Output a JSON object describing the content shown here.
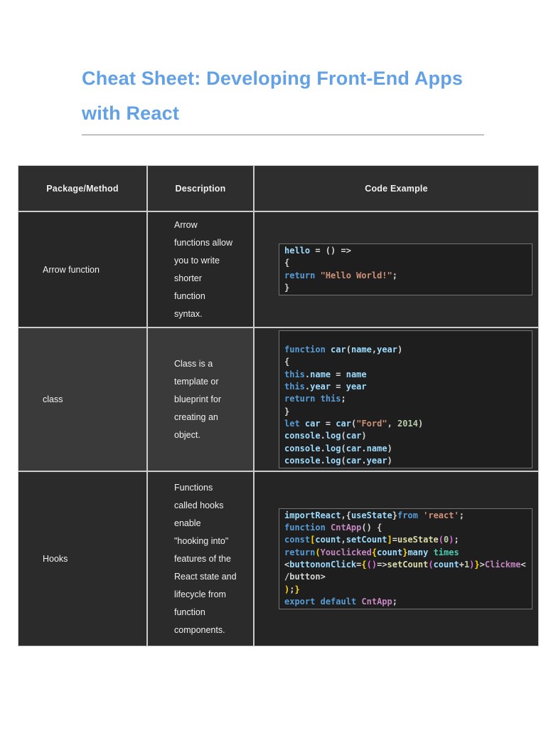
{
  "page": {
    "title": "Cheat Sheet: Developing Front-End Apps\nwith React"
  },
  "colors": {
    "title_blue": "#62A1E6",
    "table_line": "#cccccc",
    "header_bg": "#2e2e2e",
    "code_bg": "#1e1e1e",
    "keyword": "#569CD6",
    "identifier": "#9CDCFE",
    "string": "#CE9178",
    "number": "#B5CEA8",
    "function_call": "#DCDCAA",
    "component": "#C586C0",
    "type": "#4EC9B0",
    "bracket_gold": "#FFD700",
    "bracket_pink": "#DA70D6",
    "code_default": "#D4D4D4"
  },
  "table": {
    "headers": [
      "Package/Method",
      "Description",
      "Code Example"
    ],
    "rows": [
      {
        "package": "Arrow function",
        "description": "Arrow\nfunctions allow\nyou to write\nshorter\nfunction\nsyntax."
      },
      {
        "package": "class",
        "description": "Class is a\ntemplate or\nblueprint for\ncreating an\nobject."
      },
      {
        "package": "Hooks",
        "description": "Functions\ncalled hooks\nenable\n\"hooking into\"\nfeatures of the\nReact state and\nlifecycle from\nfunction\ncomponents."
      }
    ]
  },
  "code_blocks": [
    {
      "lines": [
        [
          [
            "hello",
            "id"
          ],
          [
            " = () =>",
            null
          ]
        ],
        [
          [
            "{",
            null
          ]
        ],
        [
          [
            "return",
            "kw"
          ],
          [
            " ",
            null
          ],
          [
            "\"Hello World!\"",
            "str"
          ],
          [
            ";",
            null
          ]
        ],
        [
          [
            "}",
            null
          ]
        ]
      ]
    },
    {
      "lines": [
        [
          [
            " ",
            null
          ]
        ],
        [
          [
            "function",
            "kw"
          ],
          [
            " ",
            null
          ],
          [
            "car",
            "id"
          ],
          [
            "(",
            null
          ],
          [
            "name",
            "id"
          ],
          [
            ",",
            null
          ],
          [
            "year",
            "id"
          ],
          [
            ")",
            null
          ]
        ],
        [
          [
            "{",
            null
          ]
        ],
        [
          [
            "this",
            "kw"
          ],
          [
            ".",
            null
          ],
          [
            "name",
            "id"
          ],
          [
            " = ",
            null
          ],
          [
            "name",
            "id"
          ]
        ],
        [
          [
            "this",
            "kw"
          ],
          [
            ".",
            null
          ],
          [
            "year",
            "id"
          ],
          [
            " = ",
            null
          ],
          [
            "year",
            "id"
          ]
        ],
        [
          [
            "return",
            "kw"
          ],
          [
            " ",
            null
          ],
          [
            "this",
            "kw"
          ],
          [
            ";",
            null
          ]
        ],
        [
          [
            "}",
            null
          ]
        ],
        [
          [
            "let",
            "kw"
          ],
          [
            " ",
            null
          ],
          [
            "car",
            "id"
          ],
          [
            " = ",
            null
          ],
          [
            "car",
            "id"
          ],
          [
            "(",
            null
          ],
          [
            "\"Ford\"",
            "str"
          ],
          [
            ", ",
            null
          ],
          [
            "2014",
            "num"
          ],
          [
            ")",
            null
          ]
        ],
        [
          [
            "console",
            "id"
          ],
          [
            ".",
            null
          ],
          [
            "log",
            "id"
          ],
          [
            "(",
            null
          ],
          [
            "car",
            "id"
          ],
          [
            ")",
            null
          ]
        ],
        [
          [
            "console",
            "id"
          ],
          [
            ".",
            null
          ],
          [
            "log",
            "id"
          ],
          [
            "(",
            null
          ],
          [
            "car",
            "id"
          ],
          [
            ".",
            null
          ],
          [
            "name",
            "id"
          ],
          [
            ")",
            null
          ]
        ],
        [
          [
            "console",
            "id"
          ],
          [
            ".",
            null
          ],
          [
            "log",
            "id"
          ],
          [
            "(",
            null
          ],
          [
            "car",
            "id"
          ],
          [
            ".",
            null
          ],
          [
            "year",
            "id"
          ],
          [
            ")",
            null
          ]
        ]
      ]
    },
    {
      "lines": [
        [
          [
            "importReact",
            "id"
          ],
          [
            ",",
            null
          ],
          [
            "{",
            null
          ],
          [
            "useState",
            "id"
          ],
          [
            "}",
            null
          ],
          [
            "from",
            "kw"
          ],
          [
            " ",
            null
          ],
          [
            "'react'",
            "str"
          ],
          [
            ";",
            null
          ]
        ],
        [
          [
            "function",
            "kw"
          ],
          [
            " ",
            null
          ],
          [
            "CntApp",
            "cmp"
          ],
          [
            "() {",
            null
          ]
        ],
        [
          [
            "const",
            "kw"
          ],
          [
            "[",
            "b1"
          ],
          [
            "count",
            "id"
          ],
          [
            ",",
            null
          ],
          [
            "setCount",
            "id"
          ],
          [
            "]",
            "b1"
          ],
          [
            "=",
            null
          ],
          [
            "useState",
            "fn"
          ],
          [
            "(",
            "b2"
          ],
          [
            "0",
            "num"
          ],
          [
            ")",
            "b2"
          ],
          [
            ";",
            null
          ]
        ],
        [
          [
            "return",
            "kw"
          ],
          [
            "(",
            "b1"
          ],
          [
            "Youclicked",
            "cmp"
          ],
          [
            "{",
            "b1"
          ],
          [
            "count",
            "id"
          ],
          [
            "}",
            "b1"
          ],
          [
            "many",
            "id"
          ],
          [
            " ",
            null
          ],
          [
            "times",
            "type"
          ]
        ],
        [
          [
            "<",
            null
          ],
          [
            "buttononClick",
            "id"
          ],
          [
            "=",
            null
          ],
          [
            "{",
            "b1"
          ],
          [
            "(",
            "b2"
          ],
          [
            ")",
            "b2"
          ],
          [
            "=>",
            null
          ],
          [
            "setCount",
            "fn"
          ],
          [
            "(",
            "b2"
          ],
          [
            "count",
            "id"
          ],
          [
            "+",
            null
          ],
          [
            "1",
            "num"
          ],
          [
            ")",
            "b2"
          ],
          [
            "}",
            "b1"
          ],
          [
            ">",
            null
          ],
          [
            "Clickme",
            "cmp"
          ],
          [
            "<",
            null
          ]
        ],
        [
          [
            "/button>",
            null
          ]
        ],
        [
          [
            ")",
            "b1"
          ],
          [
            ";",
            null
          ],
          [
            "}",
            "b1"
          ]
        ],
        [
          [
            "export",
            "kw"
          ],
          [
            " ",
            null
          ],
          [
            "default",
            "kw"
          ],
          [
            " ",
            null
          ],
          [
            "CntApp",
            "cmp"
          ],
          [
            ";",
            null
          ]
        ]
      ]
    }
  ]
}
